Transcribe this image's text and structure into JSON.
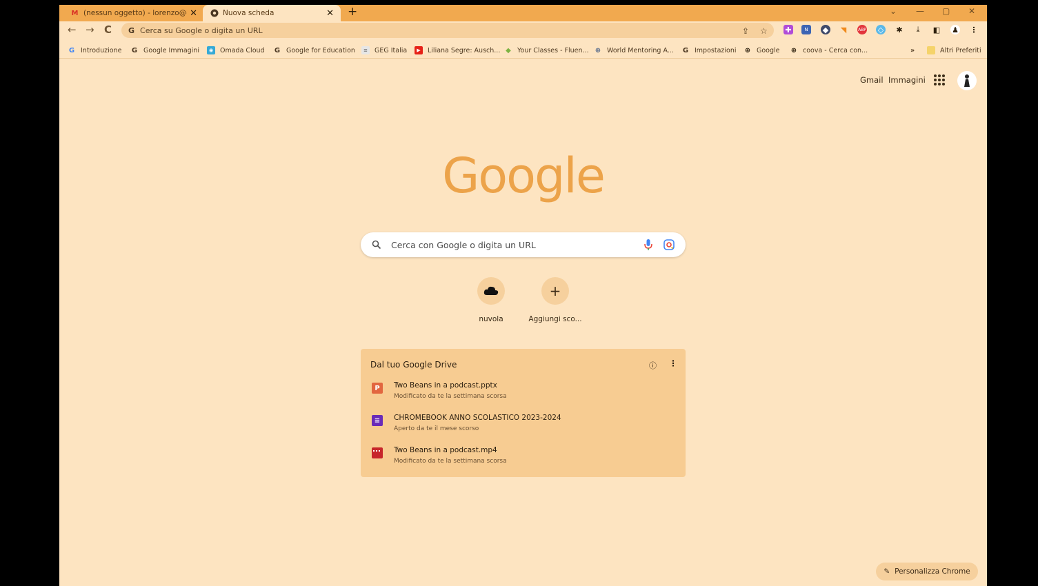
{
  "tabs": [
    {
      "title": "(nessun oggetto) - lorenzo@co...",
      "icon": "gmail-icon",
      "active": false
    },
    {
      "title": "Nuova scheda",
      "icon": "chrome-icon",
      "active": true
    }
  ],
  "toolbar": {
    "omnibox_placeholder": "Cerca su Google o digita un URL"
  },
  "bookmarks": [
    {
      "label": "Introduzione",
      "icon": "google-g-icon"
    },
    {
      "label": "Google Immagini",
      "icon": "google-g-icon"
    },
    {
      "label": "Omada Cloud",
      "icon": "omada-icon"
    },
    {
      "label": "Google for Education",
      "icon": "google-g-icon"
    },
    {
      "label": "GEG Italia",
      "icon": "geg-icon"
    },
    {
      "label": "Liliana Segre: Ausch...",
      "icon": "youtube-icon"
    },
    {
      "label": "Your Classes - Fluen...",
      "icon": "fluency-icon"
    },
    {
      "label": "World Mentoring A...",
      "icon": "world-icon"
    },
    {
      "label": "Impostazioni",
      "icon": "google-g-icon"
    },
    {
      "label": "Google",
      "icon": "globe-icon"
    },
    {
      "label": "coova - Cerca con...",
      "icon": "globe-icon"
    }
  ],
  "bookmarks_more": "»",
  "other_bookmarks": "Altri Preferiti",
  "ntp": {
    "gmail": "Gmail",
    "images": "Immagini",
    "logo": "Google",
    "search_placeholder": "Cerca con Google o digita un URL",
    "shortcuts": [
      {
        "label": "nuvola",
        "icon": "cloud-icon"
      },
      {
        "label": "Aggiungi sco...",
        "icon": "plus-icon"
      }
    ],
    "drive": {
      "title": "Dal tuo Google Drive",
      "items": [
        {
          "name": "Two Beans in a podcast.pptx",
          "sub": "Modificato da te la settimana scorsa",
          "icon": "slides-icon",
          "color": "#e2663f",
          "glyph": "P"
        },
        {
          "name": "CHROMEBOOK ANNO SCOLASTICO 2023-2024",
          "sub": "Aperto da te il mese scorso",
          "icon": "forms-icon",
          "color": "#6a2bb8",
          "glyph": "≡"
        },
        {
          "name": "Two Beans in a podcast.mp4",
          "sub": "Modificato da te la settimana scorsa",
          "icon": "video-icon",
          "color": "#c7262b",
          "glyph": "▀"
        }
      ]
    },
    "customize": "Personalizza Chrome"
  },
  "colors": {
    "tabstrip": "#f1a94f",
    "background": "#fde4c1",
    "logo": "#eca34a",
    "drive_card": "#f7cc92"
  }
}
